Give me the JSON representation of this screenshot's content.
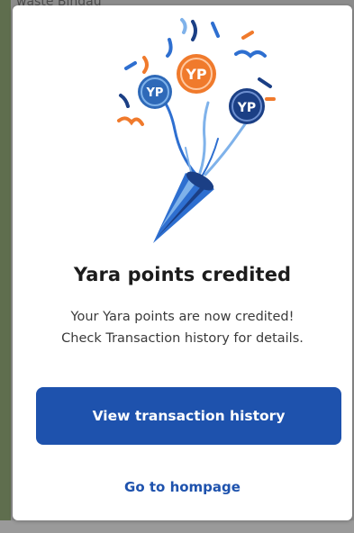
{
  "background": {
    "peek_text": "waste Bindau"
  },
  "modal": {
    "title": "Yara points credited",
    "message_line1": "Your Yara points are now credited!",
    "message_line2": "Check Transaction history for details.",
    "primary_button_label": "View transaction history",
    "secondary_link_label": "Go to hompage",
    "coin_label": "YP",
    "illustration": "party-popper-with-yara-coins-icon"
  },
  "colors": {
    "primary": "#1e52ad",
    "coin_orange": "#f07a2c",
    "coin_blue": "#2e69b8",
    "coin_navy": "#1b3f85",
    "popper_blue": "#2e6fd0",
    "popper_light": "#7fb2ea"
  }
}
